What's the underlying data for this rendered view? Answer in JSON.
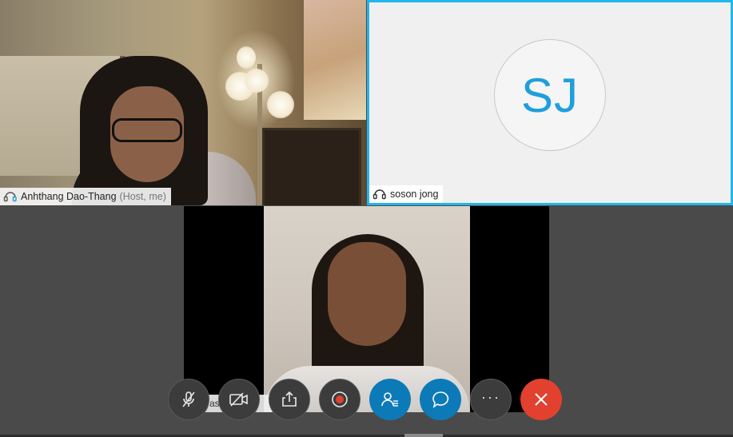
{
  "participants": {
    "host": {
      "name": "Anhthang Dao-Thang",
      "role": "(Host, me)",
      "icon": "headset-icon"
    },
    "remote": {
      "initials": "SJ",
      "name": "soson jong",
      "icon": "headset-icon"
    },
    "speaker": {
      "label_partial": "asi                w"
    }
  },
  "controls": [
    {
      "id": "mute",
      "icon": "microphone-muted-icon"
    },
    {
      "id": "video",
      "icon": "video-off-icon"
    },
    {
      "id": "share",
      "icon": "share-icon"
    },
    {
      "id": "record",
      "icon": "record-icon"
    },
    {
      "id": "participants",
      "icon": "participants-icon"
    },
    {
      "id": "chat",
      "icon": "chat-icon"
    },
    {
      "id": "more",
      "icon": "more-icon",
      "glyph": "···"
    },
    {
      "id": "end",
      "icon": "close-icon"
    }
  ],
  "colors": {
    "accent_border": "#1fb7ea",
    "initials_color": "#1f9fdc",
    "button_blue": "#0d7ab8",
    "end_red": "#e2412f",
    "background": "#4a4a4a"
  }
}
